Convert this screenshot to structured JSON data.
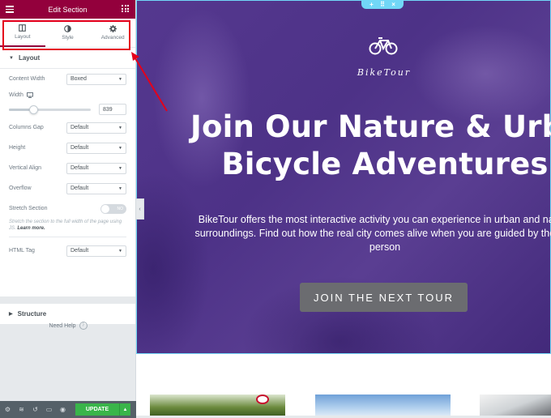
{
  "panel": {
    "title": "Edit Section",
    "tabs": [
      {
        "label": "Layout",
        "icon": "layout-icon",
        "active": true
      },
      {
        "label": "Style",
        "icon": "style-icon",
        "active": false
      },
      {
        "label": "Advanced",
        "icon": "gear-icon",
        "active": false
      }
    ],
    "layout_section": {
      "title": "Layout",
      "content_width": {
        "label": "Content Width",
        "value": "Boxed"
      },
      "width": {
        "label": "Width",
        "value": "839",
        "slider_fraction": 0.3
      },
      "columns_gap": {
        "label": "Columns Gap",
        "value": "Default"
      },
      "height": {
        "label": "Height",
        "value": "Default"
      },
      "vertical_align": {
        "label": "Vertical Align",
        "value": "Default"
      },
      "overflow": {
        "label": "Overflow",
        "value": "Default"
      },
      "stretch_section": {
        "label": "Stretch Section",
        "toggle_text": "NO",
        "note": "Stretch the section to the full width of the page using JS.",
        "note_link": "Learn more."
      },
      "html_tag": {
        "label": "HTML Tag",
        "value": "Default"
      }
    },
    "structure_section": {
      "title": "Structure"
    },
    "need_help": "Need Help",
    "footer": {
      "update_label": "UPDATE"
    }
  },
  "canvas": {
    "brand": "BikeTour",
    "headline_line1": "Join Our Nature & Urban",
    "headline_line2": "Bicycle Adventures",
    "subtext_line1": "BikeTour offers the most interactive activity you can experience in urban and nature",
    "subtext_line2": "surroundings. Find out how the real city comes alive when you are guided by the real",
    "subtext_line3": "person",
    "cta_label": "JOIN THE NEXT TOUR"
  },
  "colors": {
    "panel_header": "#93003c",
    "highlight_box": "#e4001b",
    "update_button": "#39b54a",
    "section_border": "#71d7f7",
    "cta_button": "#6b6c70"
  }
}
